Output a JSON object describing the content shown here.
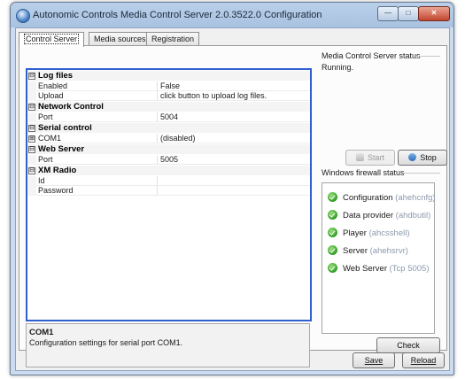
{
  "window": {
    "title": "Autonomic Controls Media Control Server 2.0.3522.0 Configuration",
    "controls": {
      "minimize": "—",
      "maximize": "□",
      "close": "✕"
    }
  },
  "tabs": [
    {
      "label": "Control Server",
      "active": true
    },
    {
      "label": "Media sources",
      "active": false
    },
    {
      "label": "Registration",
      "active": false
    }
  ],
  "property_grid": {
    "rows": [
      {
        "kind": "category",
        "expander": "⊟",
        "name": "Log files"
      },
      {
        "kind": "property",
        "name": "Enabled",
        "value": "False"
      },
      {
        "kind": "property",
        "name": "Upload",
        "value": "click button to upload log files."
      },
      {
        "kind": "category",
        "expander": "⊟",
        "name": "Network Control"
      },
      {
        "kind": "property",
        "name": "Port",
        "value": "5004"
      },
      {
        "kind": "category",
        "expander": "⊟",
        "name": "Serial control"
      },
      {
        "kind": "property",
        "expander": "⊞",
        "name": "COM1",
        "value": "(disabled)"
      },
      {
        "kind": "category",
        "expander": "⊟",
        "name": "Web Server"
      },
      {
        "kind": "property",
        "name": "Port",
        "value": "5005"
      },
      {
        "kind": "category",
        "expander": "⊟",
        "name": "XM Radio"
      },
      {
        "kind": "property",
        "name": "Id",
        "value": ""
      },
      {
        "kind": "property",
        "name": "Password",
        "value": ""
      }
    ]
  },
  "description": {
    "title": "COM1",
    "text": "Configuration settings for serial port COM1."
  },
  "server_status": {
    "heading": "Media Control Server status",
    "status": "Running.",
    "start_label": "Start",
    "stop_label": "Stop"
  },
  "firewall": {
    "heading": "Windows firewall status",
    "items": [
      {
        "name": "Configuration",
        "detail": "(ahehcnfg)"
      },
      {
        "name": "Data provider",
        "detail": "(ahdbutil)"
      },
      {
        "name": "Player",
        "detail": "(ahcsshell)"
      },
      {
        "name": "Server",
        "detail": "(ahehsrvr)"
      },
      {
        "name": "Web Server",
        "detail": "(Tcp 5005)"
      }
    ],
    "check_label": "Check"
  },
  "footer": {
    "save_label": "Save",
    "reload_label": "Reload"
  },
  "colors": {
    "focus_border": "#2f5fd0",
    "status_ok": "#2f9b24",
    "detail_text": "#8c9aae"
  }
}
